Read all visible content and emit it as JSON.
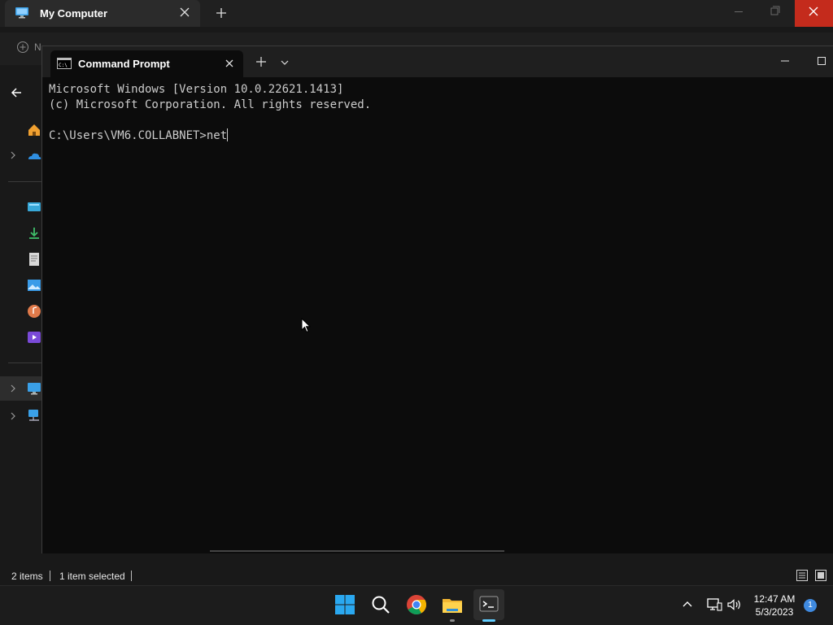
{
  "explorer": {
    "tab_title": "My Computer",
    "command_bar": {
      "new_label": "N"
    },
    "status": {
      "item_count": "2 items",
      "selected": "1 item selected"
    }
  },
  "terminal": {
    "tab_title": "Command Prompt",
    "lines": [
      "Microsoft Windows [Version 10.0.22621.1413]",
      "(c) Microsoft Corporation. All rights reserved.",
      "",
      "C:\\Users\\VM6.COLLABNET>net"
    ]
  },
  "taskbar": {
    "apps": [
      "start-icon",
      "search-icon",
      "chrome-icon",
      "file-explorer-icon",
      "terminal-icon"
    ],
    "clock_time": "12:47 AM",
    "clock_date": "5/3/2023",
    "notification_count": "1"
  },
  "colors": {
    "close_red": "#c42b1c",
    "accent_blue": "#60cdff",
    "terminal_bg": "#0c0c0c",
    "terminal_text": "#cccccc"
  }
}
